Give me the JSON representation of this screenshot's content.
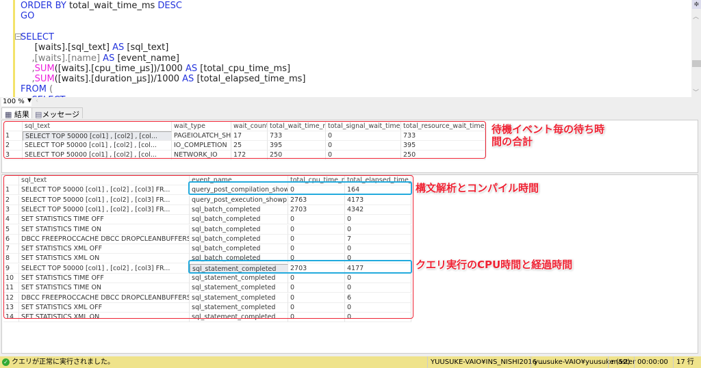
{
  "editor": {
    "lines": [
      [
        {
          "t": "ORDER BY",
          "c": "kw"
        },
        {
          "t": " total_wait_time_ms ",
          "c": ""
        },
        {
          "t": "DESC",
          "c": "kw"
        }
      ],
      [
        {
          "t": "GO",
          "c": "kw"
        }
      ],
      [],
      [
        {
          "t": "SELECT",
          "c": "kw"
        }
      ],
      [
        {
          "t": "     [waits].[sql_text] ",
          "c": ""
        },
        {
          "t": "AS",
          "c": "kw"
        },
        {
          "t": " [sql_text]",
          "c": ""
        }
      ],
      [
        {
          "t": "    ,[waits].[name] ",
          "c": "gr"
        },
        {
          "t": "AS",
          "c": "kw"
        },
        {
          "t": " [event_name]",
          "c": ""
        }
      ],
      [
        {
          "t": "    ,",
          "c": "gr"
        },
        {
          "t": "SUM",
          "c": "fn"
        },
        {
          "t": "([waits].[cpu_time_μs])/1000 ",
          "c": ""
        },
        {
          "t": "AS",
          "c": "kw"
        },
        {
          "t": " [total_cpu_time_ms]",
          "c": ""
        }
      ],
      [
        {
          "t": "    ,",
          "c": "gr"
        },
        {
          "t": "SUM",
          "c": "fn"
        },
        {
          "t": "([waits].[duration_μs])/1000 ",
          "c": ""
        },
        {
          "t": "AS",
          "c": "kw"
        },
        {
          "t": " [total_elapsed_time_ms]",
          "c": ""
        }
      ],
      [
        {
          "t": "FROM",
          "c": "kw"
        },
        {
          "t": " (",
          "c": "gr"
        }
      ],
      [
        {
          "t": "    SELECT",
          "c": "kw"
        }
      ]
    ]
  },
  "zoom": "100 %",
  "tabs": {
    "results": "結果",
    "messages": "メッセージ"
  },
  "grid1": {
    "headers": [
      "",
      "sql_text",
      "wait_type",
      "wait_count",
      "total_wait_time_ms",
      "total_signal_wait_time_ms",
      "total_resource_wait_time_ms"
    ],
    "rows": [
      [
        "1",
        "SELECT TOP 50000    [col1] , [col2]      , [col...",
        "PAGEIOLATCH_SH",
        "17",
        "733",
        "0",
        "733"
      ],
      [
        "2",
        "SELECT TOP 50000    [col1] , [col2]      , [col...",
        "IO_COMPLETION",
        "25",
        "395",
        "0",
        "395"
      ],
      [
        "3",
        "SELECT TOP 50000    [col1] , [col2]      , [col...",
        "NETWORK_IO",
        "172",
        "250",
        "0",
        "250"
      ]
    ]
  },
  "grid2": {
    "headers": [
      "",
      "sql_text",
      "event_name",
      "total_cpu_time_ms",
      "total_elapsed_time_ms"
    ],
    "rows": [
      [
        "1",
        " SELECT TOP 50000    [col1] , [col2]      , [col3]   FR...",
        "query_post_compilation_showplan",
        "0",
        "164"
      ],
      [
        "2",
        " SELECT TOP 50000    [col1] , [col2]      , [col3]   FR...",
        "query_post_execution_showplan",
        "2763",
        "4173"
      ],
      [
        "3",
        " SELECT TOP 50000    [col1] , [col2]      , [col3]   FR...",
        "sql_batch_completed",
        "2703",
        "4342"
      ],
      [
        "4",
        " SET STATISTICS TIME OFF",
        "sql_batch_completed",
        "0",
        "0"
      ],
      [
        "5",
        " SET STATISTICS TIME ON",
        "sql_batch_completed",
        "0",
        "0"
      ],
      [
        "6",
        "DBCC FREEPROCCACHE DBCC DROPCLEANBUFFERS",
        "sql_batch_completed",
        "0",
        "7"
      ],
      [
        "7",
        "SET STATISTICS XML OFF",
        "sql_batch_completed",
        "0",
        "0"
      ],
      [
        "8",
        "SET STATISTICS XML ON",
        "sql_batch_completed",
        "0",
        "0"
      ],
      [
        "9",
        " SELECT TOP 50000    [col1] , [col2]      , [col3]   FR...",
        "sql_statement_completed",
        "2703",
        "4177"
      ],
      [
        "10",
        " SET STATISTICS TIME OFF",
        "sql_statement_completed",
        "0",
        "0"
      ],
      [
        "11",
        " SET STATISTICS TIME ON",
        "sql_statement_completed",
        "0",
        "0"
      ],
      [
        "12",
        "DBCC FREEPROCCACHE DBCC DROPCLEANBUFFERS",
        "sql_statement_completed",
        "0",
        "6"
      ],
      [
        "13",
        "SET STATISTICS XML OFF",
        "sql_statement_completed",
        "0",
        "0"
      ],
      [
        "14",
        "SET STATISTICS XML ON",
        "sql_statement_completed",
        "0",
        "0"
      ]
    ]
  },
  "annotations": {
    "a1_line1": "待機イベント毎の待ち時",
    "a1_line2": "間の合計",
    "a2": "構文解析とコンパイル時間",
    "a3": "クエリ実行のCPU時間と経過時間"
  },
  "status": {
    "message": "クエリが正常に実行されました。",
    "server": "YUUSUKE-VAIO¥INS_NISHI2016 ...",
    "user": "yuusuke-VAIO¥yuusuke (52)",
    "database": "master",
    "elapsed": "00:00:00",
    "rows": "17 行"
  },
  "colors": {
    "annotation": "#ee2233",
    "highlight": "#22aadd",
    "statusbar": "#efe38b"
  }
}
